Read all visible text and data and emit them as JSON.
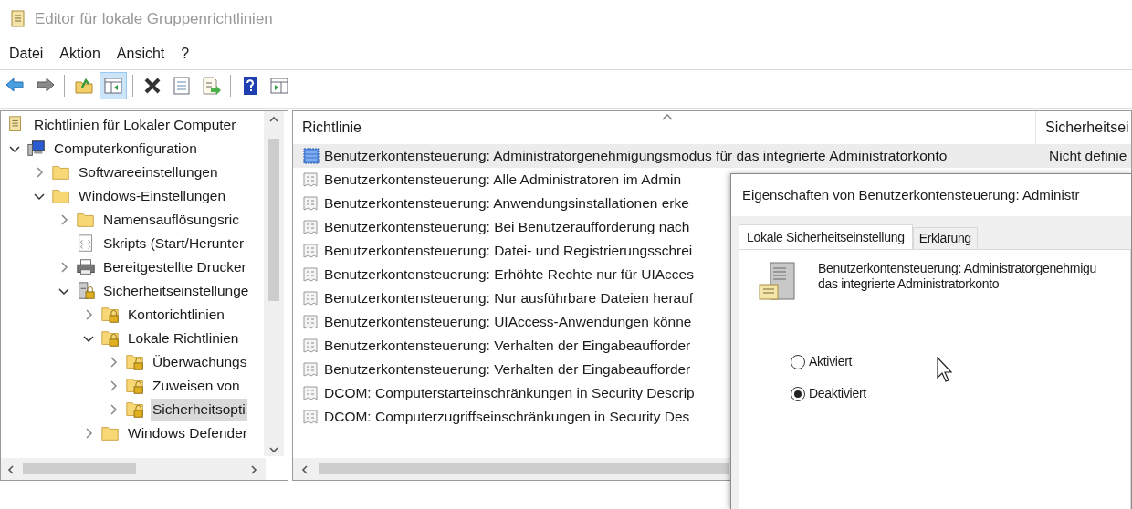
{
  "window": {
    "title": "Editor für lokale Gruppenrichtlinien"
  },
  "menu": [
    "Datei",
    "Aktion",
    "Ansicht",
    "?"
  ],
  "toolbar": [
    {
      "pressed": false
    },
    {
      "pressed": false
    },
    {
      "pressed": false
    },
    {
      "pressed": true
    },
    {
      "pressed": false
    },
    {
      "pressed": false
    },
    {
      "pressed": false
    },
    {
      "pressed": false
    },
    {
      "pressed": false
    }
  ],
  "tree_root": {
    "label": "Richtlinien für Lokaler Computer",
    "kind": "policy",
    "selected": false
  },
  "tree": [
    {
      "label": "Computerkonfiguration",
      "kind": "computer",
      "expanded": true,
      "selected": false,
      "children": [
        {
          "label": "Softwareeinstellungen",
          "kind": "folder",
          "expanded": false,
          "selected": false
        },
        {
          "label": "Windows-Einstellungen",
          "kind": "folder",
          "expanded": true,
          "selected": false,
          "children": [
            {
              "label": "Namensauflösungsric",
              "kind": "folder",
              "expanded": false,
              "selected": false
            },
            {
              "label": "Skripts (Start/Herunter",
              "kind": "script",
              "selected": false
            },
            {
              "label": "Bereitgestellte Drucker",
              "kind": "printer",
              "expanded": false,
              "selected": false
            },
            {
              "label": "Sicherheitseinstellunge",
              "kind": "security",
              "expanded": true,
              "selected": false,
              "children": [
                {
                  "label": "Kontorichtlinien",
                  "kind": "secured_folder",
                  "expanded": false,
                  "selected": false
                },
                {
                  "label": "Lokale Richtlinien",
                  "kind": "secured_folder",
                  "expanded": true,
                  "selected": false,
                  "children": [
                    {
                      "label": "Überwachungs",
                      "kind": "secured_folder",
                      "expanded": false,
                      "selected": false
                    },
                    {
                      "label": "Zuweisen von",
                      "kind": "secured_folder",
                      "expanded": false,
                      "selected": false
                    },
                    {
                      "label": "Sicherheitsopti",
                      "kind": "secured_folder",
                      "expanded": false,
                      "selected": true
                    }
                  ]
                },
                {
                  "label": "Windows Defender",
                  "kind": "folder",
                  "expanded": false,
                  "selected": false
                }
              ]
            }
          ]
        }
      ]
    }
  ],
  "table": {
    "columns": [
      "Richtlinie",
      "Sicherheitsei"
    ],
    "rows": [
      {
        "policy": "Benutzerkontensteuerung: Administratorgenehmigungsmodus für das integrierte Administratorkonto",
        "setting": "Nicht definie",
        "selected": true
      },
      {
        "policy": "Benutzerkontensteuerung: Alle Administratoren im Admin",
        "selected": false
      },
      {
        "policy": "Benutzerkontensteuerung: Anwendungsinstallationen erke",
        "selected": false
      },
      {
        "policy": "Benutzerkontensteuerung: Bei Benutzeraufforderung nach",
        "selected": false
      },
      {
        "policy": "Benutzerkontensteuerung: Datei- und Registrierungsschrei",
        "selected": false
      },
      {
        "policy": "Benutzerkontensteuerung: Erhöhte Rechte nur für UIAcces",
        "selected": false
      },
      {
        "policy": "Benutzerkontensteuerung: Nur ausführbare Dateien herauf",
        "selected": false
      },
      {
        "policy": "Benutzerkontensteuerung: UIAccess-Anwendungen könne",
        "selected": false
      },
      {
        "policy": "Benutzerkontensteuerung: Verhalten der Eingabeaufforder",
        "selected": false
      },
      {
        "policy": "Benutzerkontensteuerung: Verhalten der Eingabeaufforder",
        "selected": false
      },
      {
        "policy": "DCOM: Computerstarteinschränkungen in Security Descrip",
        "selected": false
      },
      {
        "policy": "DCOM: Computerzugriffseinschränkungen in Security Des",
        "selected": false
      }
    ]
  },
  "dialog": {
    "title": "Eigenschaften von Benutzerkontensteuerung: Administr",
    "tabs": [
      {
        "label": "Lokale Sicherheitseinstellung",
        "selected": true
      },
      {
        "label": "Erklärung",
        "selected": false
      }
    ],
    "description_lines": [
      "Benutzerkontensteuerung: Administratorgenehmigu",
      "das integrierte Administratorkonto"
    ],
    "options": [
      {
        "label": "Aktiviert",
        "selected": false
      },
      {
        "label": "Deaktiviert",
        "selected": true
      }
    ]
  }
}
